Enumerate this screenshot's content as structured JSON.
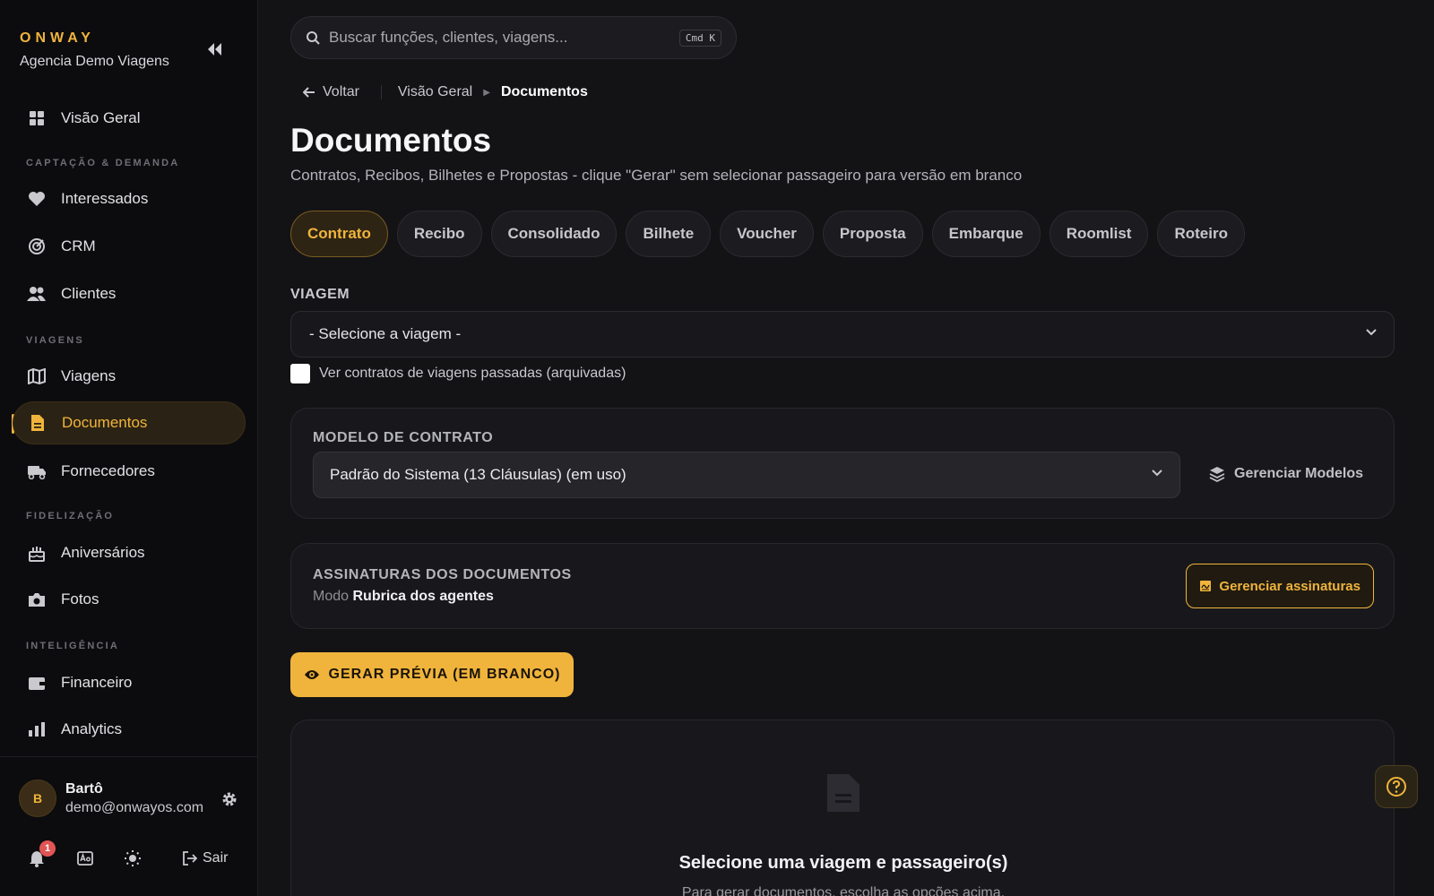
{
  "brand": {
    "name": "ONWAY",
    "agency": "Agencia Demo Viagens"
  },
  "sidebar": {
    "overview": "Visão Geral",
    "sections": {
      "captacao": "CAPTAÇÃO & DEMANDA",
      "viagens": "VIAGENS",
      "fidelizacao": "FIDELIZAÇÃO",
      "inteligencia": "INTELIGÊNCIA"
    },
    "items": {
      "interessados": "Interessados",
      "crm": "CRM",
      "clientes": "Clientes",
      "viagens": "Viagens",
      "documentos": "Documentos",
      "fornecedores": "Fornecedores",
      "aniversarios": "Aniversários",
      "fotos": "Fotos",
      "financeiro": "Financeiro",
      "analytics": "Analytics"
    },
    "active": "Documentos"
  },
  "user": {
    "initial": "B",
    "name": "Bartô",
    "email": "demo@onwayos.com"
  },
  "footer": {
    "notifications": "1",
    "logout": "Sair"
  },
  "search": {
    "placeholder": "Buscar funções, clientes, viagens...",
    "shortcut": "Cmd K"
  },
  "breadcrumb": {
    "back": "Voltar",
    "parent": "Visão Geral",
    "current": "Documentos"
  },
  "page": {
    "title": "Documentos",
    "subtitle": "Contratos, Recibos, Bilhetes e Propostas - clique \"Gerar\" sem selecionar passageiro para versão em branco"
  },
  "tabs": [
    "Contrato",
    "Recibo",
    "Consolidado",
    "Bilhete",
    "Voucher",
    "Proposta",
    "Embarque",
    "Roomlist",
    "Roteiro"
  ],
  "active_tab": "Contrato",
  "trip": {
    "label": "VIAGEM",
    "selected": "- Selecione a viagem -",
    "archived_checkbox": "Ver contratos de viagens passadas (arquivadas)",
    "archived_checked": false
  },
  "contract_model": {
    "label": "MODELO DE CONTRATO",
    "selected": "Padrão do Sistema (13 Cláusulas) (em uso)",
    "manage": "Gerenciar Modelos"
  },
  "signatures": {
    "label": "ASSINATURAS DOS DOCUMENTOS",
    "mode_prefix": "Modo",
    "mode_value": "Rubrica dos agentes",
    "manage": "Gerenciar assinaturas"
  },
  "generate_button": "GERAR PRÉVIA (EM BRANCO)",
  "empty_state": {
    "title": "Selecione uma viagem e passageiro(s)",
    "subtitle": "Para gerar documentos, escolha as opções acima."
  },
  "colors": {
    "accent": "#f0b43c",
    "background": "#131316",
    "sidebar": "#0c0c0e",
    "badge": "#e25555"
  }
}
